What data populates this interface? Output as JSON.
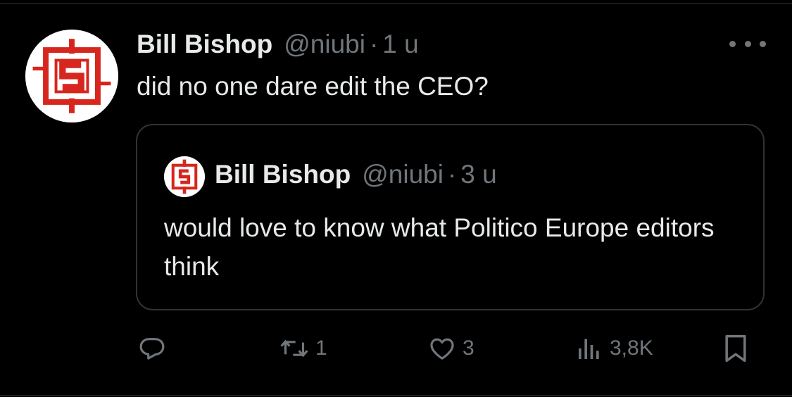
{
  "tweet": {
    "author_name": "Bill Bishop",
    "handle": "@niubi",
    "separator": "·",
    "time": "1 u",
    "text": "did no one dare edit the CEO?"
  },
  "quoted_tweet": {
    "author_name": "Bill Bishop",
    "handle": "@niubi",
    "separator": "·",
    "time": "3 u",
    "text": "would love to know what Politico Europe editors think"
  },
  "actions": {
    "reply_count": "",
    "retweet_count": "1",
    "like_count": "3",
    "views_count": "3,8K"
  },
  "icons": [
    "avatar-logo",
    "more-icon",
    "reply-icon",
    "retweet-icon",
    "like-icon",
    "views-icon",
    "bookmark-icon"
  ],
  "colors": {
    "background": "#000000",
    "text_primary": "#e7e9ea",
    "text_secondary": "#71767b",
    "border": "#2f3336",
    "logo_red": "#d7261e"
  }
}
